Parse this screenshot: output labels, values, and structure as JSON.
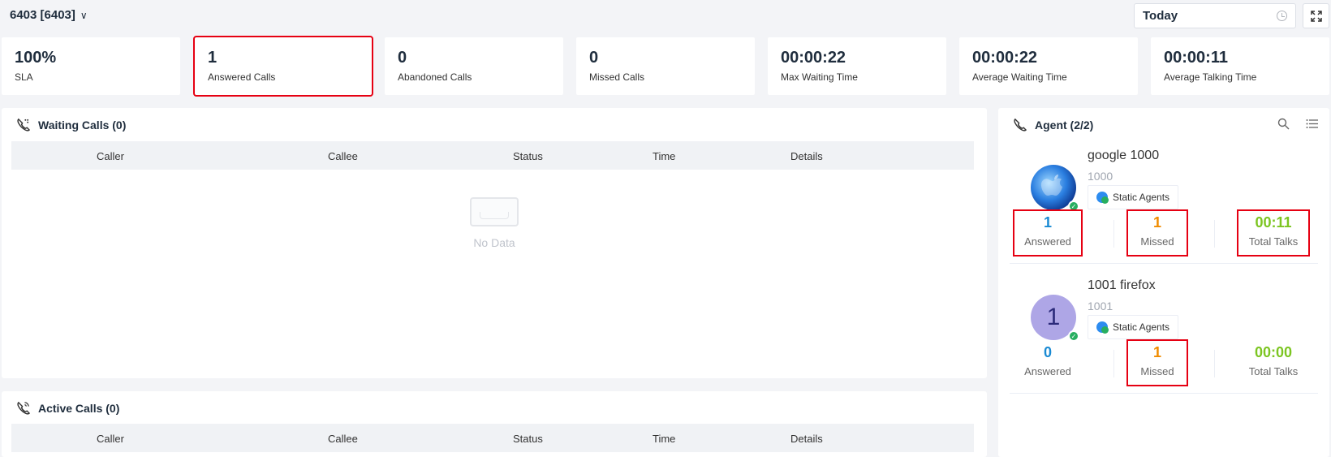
{
  "header": {
    "queue_label": "6403 [6403]",
    "date_value": "Today"
  },
  "stats": [
    {
      "value": "100%",
      "label": "SLA"
    },
    {
      "value": "1",
      "label": "Answered Calls"
    },
    {
      "value": "0",
      "label": "Abandoned Calls"
    },
    {
      "value": "0",
      "label": "Missed Calls"
    },
    {
      "value": "00:00:22",
      "label": "Max Waiting Time"
    },
    {
      "value": "00:00:22",
      "label": "Average Waiting Time"
    },
    {
      "value": "00:00:11",
      "label": "Average Talking Time"
    }
  ],
  "waiting_calls": {
    "title": "Waiting Calls (0)",
    "columns": [
      "Caller",
      "Callee",
      "Status",
      "Time",
      "Details"
    ],
    "empty_text": "No Data"
  },
  "active_calls": {
    "title": "Active Calls (0)",
    "columns": [
      "Caller",
      "Callee",
      "Status",
      "Time",
      "Details"
    ]
  },
  "agents": {
    "title": "Agent (2/2)",
    "items": [
      {
        "name": "google 1000",
        "extension": "1000",
        "tag": "Static Agents",
        "avatar": "apple-logo-image",
        "answered": "1",
        "answered_label": "Answered",
        "missed": "1",
        "missed_label": "Missed",
        "total_talks": "00:11",
        "total_talks_label": "Total Talks"
      },
      {
        "name": "1001 firefox",
        "extension": "1001",
        "tag": "Static Agents",
        "avatar_text": "1",
        "answered": "0",
        "answered_label": "Answered",
        "missed": "1",
        "missed_label": "Missed",
        "total_talks": "00:00",
        "total_talks_label": "Total Talks"
      }
    ]
  },
  "colors": {
    "highlight": "#e60012",
    "answered": "#1a8ad3",
    "missed": "#f08c00",
    "talks": "#7cc521"
  }
}
